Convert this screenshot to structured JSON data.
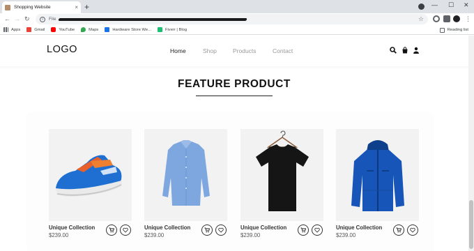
{
  "browser": {
    "tab_title": "Shopping Website",
    "tab_close": "×",
    "new_tab": "+",
    "window_controls": {
      "minimize": "—",
      "maximize": "☐",
      "close": "✕"
    },
    "nav": {
      "back": "←",
      "forward": "→",
      "reload": "↻"
    },
    "address": {
      "scheme": "File",
      "info_glyph": "i"
    },
    "star": "☆",
    "menu": "⋮",
    "bookmarks": [
      {
        "label": "Apps",
        "icon": "apps-grid-icon",
        "color": "#5f6368"
      },
      {
        "label": "Gmail",
        "icon": "gmail-icon",
        "color": "#ea4335"
      },
      {
        "label": "YouTube",
        "icon": "youtube-icon",
        "color": "#ff0000"
      },
      {
        "label": "Maps",
        "icon": "maps-icon",
        "color": "#34a853"
      },
      {
        "label": "Hardware Store We...",
        "icon": "hardware-store-icon",
        "color": "#1a73e8"
      },
      {
        "label": "Fiverr | Blog",
        "icon": "fiverr-icon",
        "color": "#1dbf73"
      }
    ],
    "reading_list": "Reading list"
  },
  "site": {
    "logo": "LOGO",
    "nav": [
      {
        "label": "Home",
        "active": true
      },
      {
        "label": "Shop",
        "active": false
      },
      {
        "label": "Products",
        "active": false
      },
      {
        "label": "Contact",
        "active": false
      }
    ],
    "header_icons": [
      "search-icon",
      "shopping-bag-icon",
      "user-icon"
    ],
    "section_title": "FEATURE PRODUCT",
    "products": [
      {
        "name": "Unique Collection",
        "price": "$239.00",
        "image": "blue-sneaker"
      },
      {
        "name": "Unique Collection",
        "price": "$239.00",
        "image": "blue-shirt"
      },
      {
        "name": "Unique Collection",
        "price": "$239.00",
        "image": "black-tshirt"
      },
      {
        "name": "Unique Collection",
        "price": "$239.00",
        "image": "blue-jacket"
      }
    ]
  },
  "colors": {
    "accent": "#111111",
    "muted_nav": "#999999",
    "card_bg": "#f2f2f2"
  }
}
